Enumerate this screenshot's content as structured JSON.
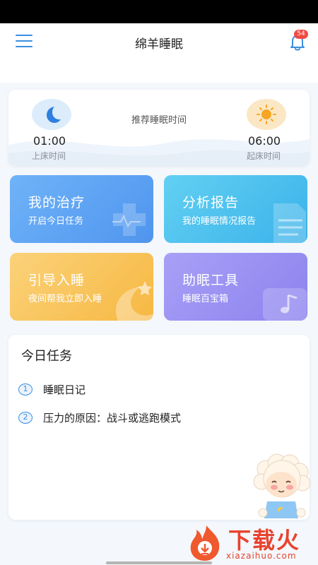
{
  "header": {
    "title": "绵羊睡眠",
    "notification_count": "54",
    "menu_icon": "hamburger-menu-icon",
    "bell_icon": "bell-icon"
  },
  "sleep_schedule": {
    "recommend_label": "推荐睡眠时间",
    "bedtime": {
      "time": "01:00",
      "label": "上床时间",
      "icon": "moon-icon"
    },
    "waketime": {
      "time": "06:00",
      "label": "起床时间",
      "icon": "sun-icon"
    }
  },
  "tiles": [
    {
      "title": "我的治疗",
      "subtitle": "开启今日任务",
      "icon": "medical-cross-icon",
      "color": "#5fa6f5"
    },
    {
      "title": "分析报告",
      "subtitle": "我的睡眠情况报告",
      "icon": "report-document-icon",
      "color": "#52c3ef"
    },
    {
      "title": "引导入睡",
      "subtitle": "夜间帮我立即入睡",
      "icon": "moon-star-icon",
      "color": "#f8c45c"
    },
    {
      "title": "助眠工具",
      "subtitle": "睡眠百宝箱",
      "icon": "music-note-icon",
      "color": "#9b92f2"
    }
  ],
  "today_tasks": {
    "title": "今日任务",
    "items": [
      {
        "number": "1",
        "text": "睡眠日记"
      },
      {
        "number": "2",
        "text": "压力的原因：战斗或逃跑模式"
      }
    ]
  },
  "watermark": {
    "text": "下载火",
    "domain": "xiazaihuo.com"
  },
  "colors": {
    "accent": "#3b8fe0",
    "badge": "#f24a44",
    "background": "#f4f7fb"
  }
}
